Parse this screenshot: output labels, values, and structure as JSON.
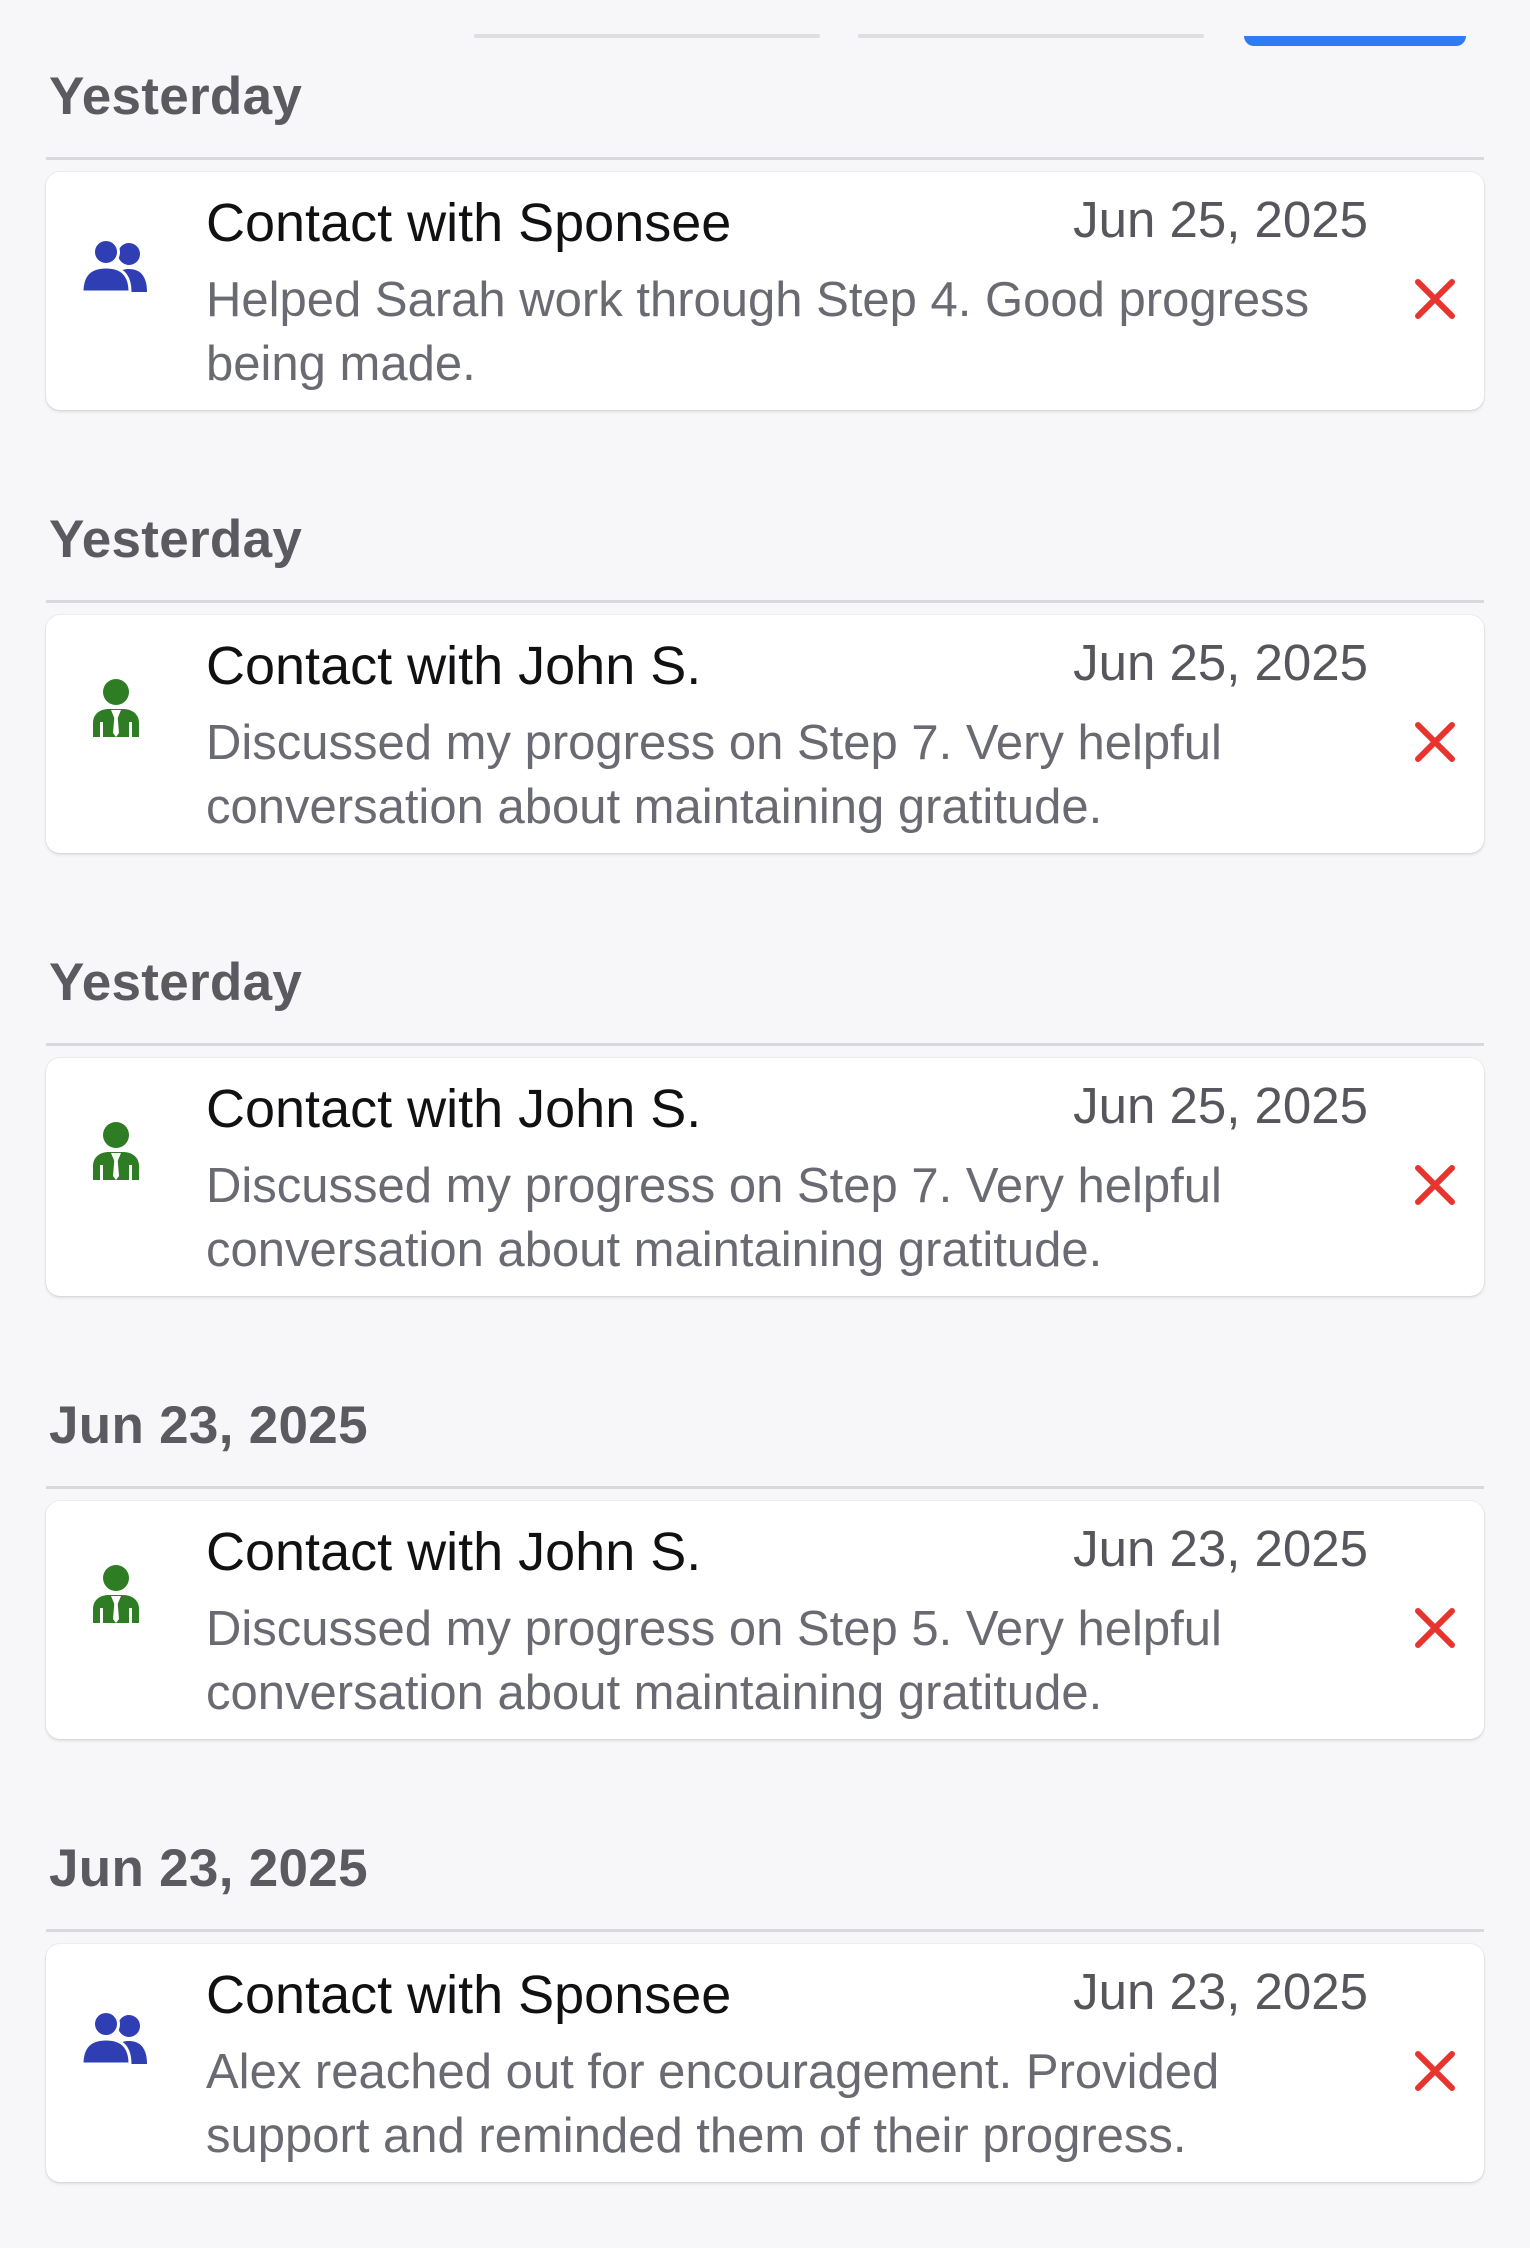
{
  "colors": {
    "sponsee_icon": "#2f3fb3",
    "sponsor_icon": "#2e7d25",
    "delete": "#e8342f",
    "accent": "#2f7bf5"
  },
  "entries": [
    {
      "group_label": "Yesterday",
      "title": "Contact with Sponsee",
      "date": "Jun 25, 2025",
      "note": "Helped Sarah work through Step 4. Good progress being made.",
      "icon": "people-group-icon"
    },
    {
      "group_label": "Yesterday",
      "title": "Contact with John S.",
      "date": "Jun 25, 2025",
      "note": "Discussed my progress on Step 7. Very helpful conversation about maintaining gratitude.",
      "icon": "person-tie-icon"
    },
    {
      "group_label": "Yesterday",
      "title": "Contact with John S.",
      "date": "Jun 25, 2025",
      "note": "Discussed my progress on Step 7. Very helpful conversation about maintaining gratitude.",
      "icon": "person-tie-icon"
    },
    {
      "group_label": "Jun 23, 2025",
      "title": "Contact with John S.",
      "date": "Jun 23, 2025",
      "note": "Discussed my progress on Step 5. Very helpful conversation about maintaining gratitude.",
      "icon": "person-tie-icon"
    },
    {
      "group_label": "Jun 23, 2025",
      "title": "Contact with Sponsee",
      "date": "Jun 23, 2025",
      "note": "Alex reached out for encouragement. Provided support and reminded them of their progress.",
      "icon": "people-group-icon"
    }
  ]
}
